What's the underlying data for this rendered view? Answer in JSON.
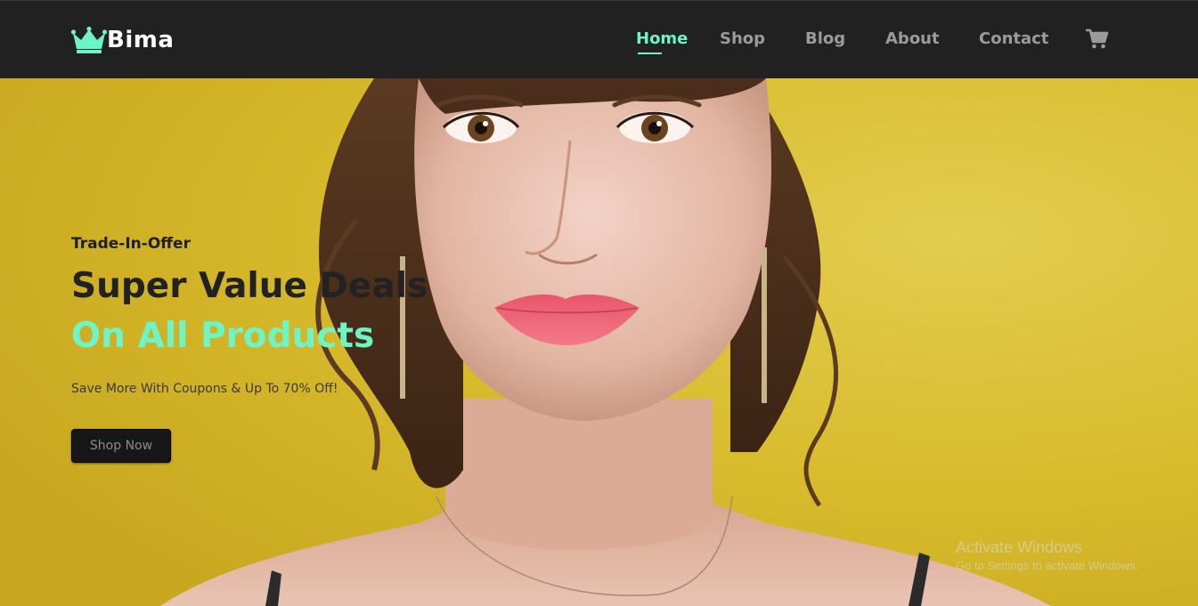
{
  "brand": {
    "name": "Bima",
    "icon": "crown-icon",
    "accent_color": "#6ef5c6"
  },
  "nav": {
    "items": [
      {
        "label": "Home",
        "active": true
      },
      {
        "label": "Shop",
        "active": false
      },
      {
        "label": "Blog",
        "active": false
      },
      {
        "label": "About",
        "active": false
      },
      {
        "label": "Contact",
        "active": false
      }
    ],
    "cart_icon": "shopping-cart-icon"
  },
  "hero": {
    "offer_label": "Trade-In-Offer",
    "headline_line1": "Super Value Deals",
    "headline_line2": "On All Products",
    "subtext": "Save More With Coupons & Up To 70% Off!",
    "button_label": "Shop Now",
    "background_color": "#d8b92b"
  },
  "watermark": {
    "title": "Activate Windows",
    "subtitle": "Go to Settings to activate Windows."
  }
}
